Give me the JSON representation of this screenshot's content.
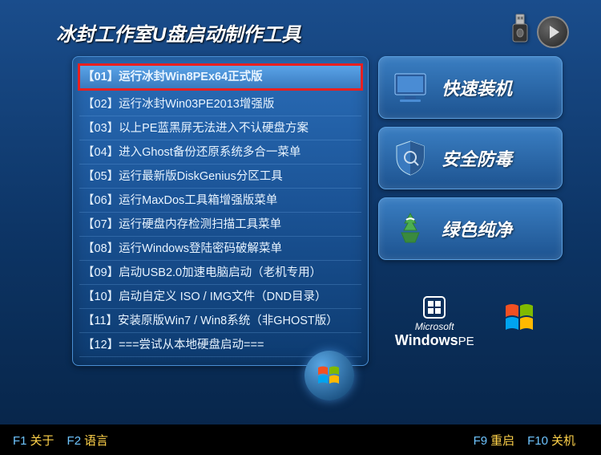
{
  "title": "冰封工作室U盘启动制作工具",
  "menu": [
    {
      "label": "【01】运行冰封Win8PEx64正式版",
      "selected": true
    },
    {
      "label": "【02】运行冰封Win03PE2013增强版"
    },
    {
      "label": "【03】以上PE蓝黑屏无法进入不认硬盘方案"
    },
    {
      "label": "【04】进入Ghost备份还原系统多合一菜单"
    },
    {
      "label": "【05】运行最新版DiskGenius分区工具"
    },
    {
      "label": "【06】运行MaxDos工具箱增强版菜单"
    },
    {
      "label": "【07】运行硬盘内存检测扫描工具菜单"
    },
    {
      "label": "【08】运行Windows登陆密码破解菜单"
    },
    {
      "label": "【09】启动USB2.0加速电脑启动（老机专用）"
    },
    {
      "label": "【10】启动自定义 ISO / IMG文件（DND目录）"
    },
    {
      "label": "【11】安装原版Win7 / Win8系统（非GHOST版）"
    },
    {
      "label": "【12】===尝试从本地硬盘启动==="
    }
  ],
  "cards": [
    {
      "label": "快速装机",
      "icon": "computer-icon"
    },
    {
      "label": "安全防毒",
      "icon": "shield-icon"
    },
    {
      "label": "绿色纯净",
      "icon": "recycle-icon"
    }
  ],
  "logos": {
    "ms_line1": "Microsoft",
    "ms_line2": "Windows",
    "ms_suffix": "PE"
  },
  "footer": {
    "f1_key": "F1",
    "f1_label": "关于",
    "f2_key": "F2",
    "f2_label": "语言",
    "f9_key": "F9",
    "f9_label": "重启",
    "f10_key": "F10",
    "f10_label": "关机"
  }
}
